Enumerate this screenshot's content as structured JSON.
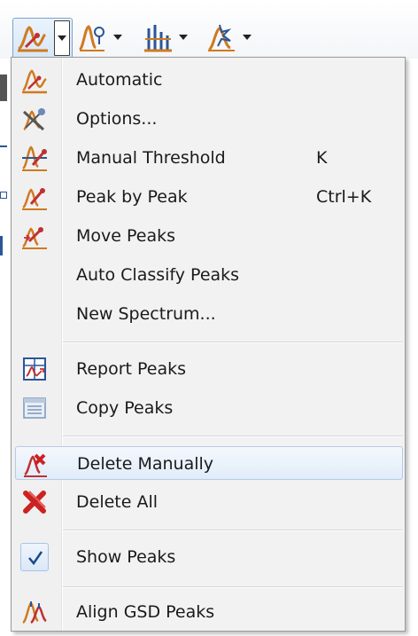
{
  "toolbar": {
    "buttons": [
      {
        "name": "peak-picking",
        "icon": "peak-pick-icon"
      },
      {
        "name": "peak-tool-2",
        "icon": "peak-ruler-icon"
      },
      {
        "name": "peak-tool-3",
        "icon": "bar-peaks-icon"
      },
      {
        "name": "peak-tool-4",
        "icon": "burst-peaks-icon"
      }
    ]
  },
  "menu": {
    "items": [
      {
        "label": "Automatic",
        "shortcut": "",
        "icon": "automatic-peaks-icon"
      },
      {
        "label": "Options...",
        "shortcut": "",
        "icon": "options-peaks-icon"
      },
      {
        "label": "Manual Threshold",
        "shortcut": "K",
        "icon": "manual-threshold-icon"
      },
      {
        "label": "Peak by Peak",
        "shortcut": "Ctrl+K",
        "icon": "peak-by-peak-icon"
      },
      {
        "label": "Move Peaks",
        "shortcut": "",
        "icon": "move-peaks-icon"
      },
      {
        "label": "Auto Classify Peaks",
        "shortcut": "",
        "icon": ""
      },
      {
        "label": "New Spectrum...",
        "shortcut": "",
        "icon": ""
      },
      {
        "label": "Report Peaks",
        "shortcut": "",
        "icon": "report-peaks-icon"
      },
      {
        "label": "Copy Peaks",
        "shortcut": "",
        "icon": "copy-peaks-icon"
      },
      {
        "label": "Delete Manually",
        "shortcut": "",
        "icon": "delete-manually-icon",
        "highlighted": true
      },
      {
        "label": "Delete All",
        "shortcut": "",
        "icon": "delete-all-icon"
      },
      {
        "label": "Show Peaks",
        "shortcut": "",
        "icon": "checkmark-icon",
        "checked": true
      },
      {
        "label": "Align GSD Peaks",
        "shortcut": "",
        "icon": "align-gsd-icon"
      }
    ]
  },
  "colors": {
    "highlight_border": "#b5cbe6",
    "highlight_fill": "#e1ecf9",
    "icon_red": "#cc2222",
    "icon_blue": "#2a5599"
  }
}
